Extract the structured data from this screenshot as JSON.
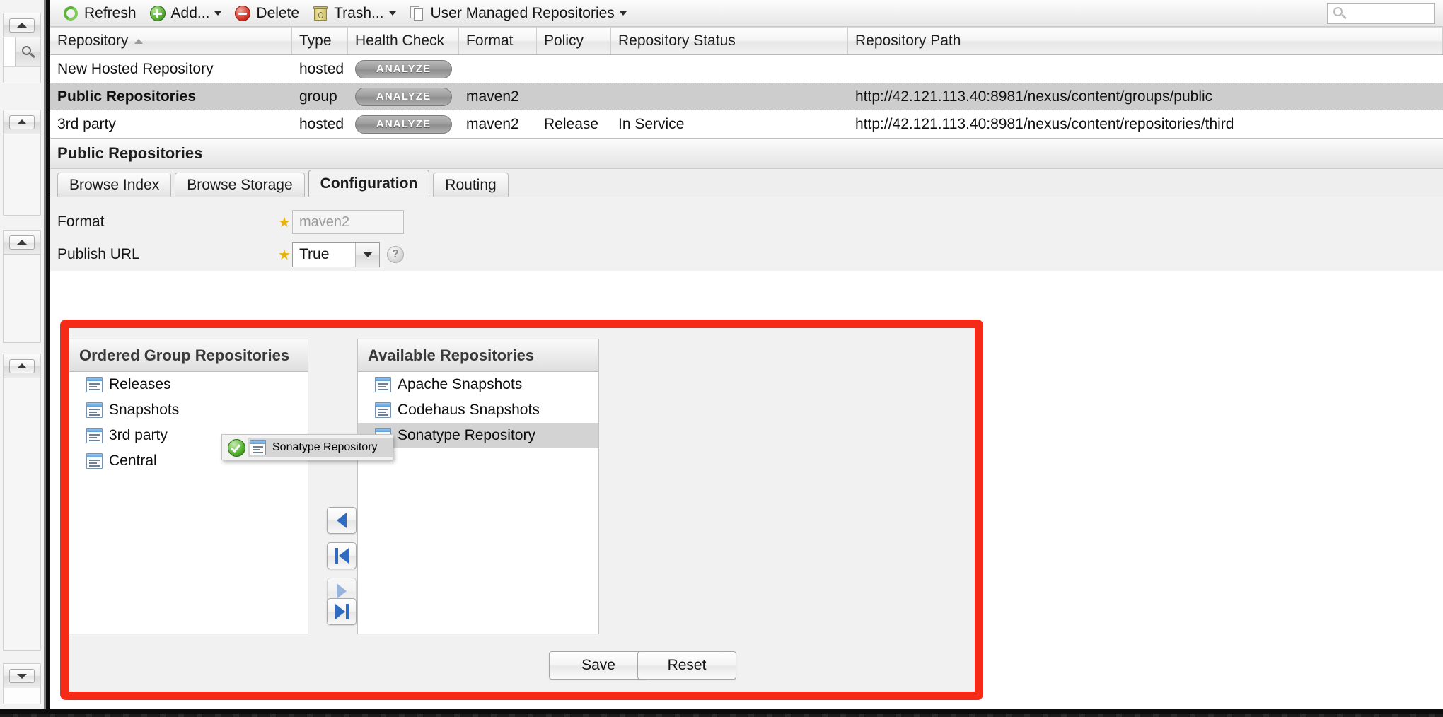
{
  "toolbar": {
    "items": [
      {
        "label": "Refresh",
        "icon": "refresh-icon",
        "caret": false
      },
      {
        "label": "Add...",
        "icon": "add-icon",
        "caret": true
      },
      {
        "label": "Delete",
        "icon": "delete-icon",
        "caret": false
      },
      {
        "label": "Trash...",
        "icon": "trash-icon",
        "caret": true
      },
      {
        "label": "User Managed Repositories",
        "icon": "pages-icon",
        "caret": true
      }
    ],
    "search": {
      "value": "",
      "placeholder": "",
      "icon": "search-icon"
    }
  },
  "grid": {
    "columns": [
      {
        "label": "Repository",
        "sorted": true,
        "sort_dir": "asc"
      },
      {
        "label": "Type"
      },
      {
        "label": "Health Check"
      },
      {
        "label": "Format"
      },
      {
        "label": "Policy"
      },
      {
        "label": "Repository Status"
      },
      {
        "label": "Repository Path"
      }
    ],
    "health_check_label": "ANALYZE",
    "rows": [
      {
        "repository": "New Hosted Repository",
        "type": "hosted",
        "health": "ANALYZE",
        "format": "",
        "policy": "",
        "status": "",
        "path": "",
        "selected": false
      },
      {
        "repository": "Public Repositories",
        "type": "group",
        "health": "ANALYZE",
        "format": "maven2",
        "policy": "",
        "status": "",
        "path": "http://42.121.113.40:8981/nexus/content/groups/public",
        "selected": true
      },
      {
        "repository": "3rd party",
        "type": "hosted",
        "health": "ANALYZE",
        "format": "maven2",
        "policy": "Release",
        "status": "In Service",
        "path": "http://42.121.113.40:8981/nexus/content/repositories/third",
        "selected": false
      }
    ]
  },
  "detail": {
    "title": "Public Repositories",
    "tabs": [
      {
        "label": "Browse Index",
        "active": false
      },
      {
        "label": "Browse Storage",
        "active": false
      },
      {
        "label": "Configuration",
        "active": true
      },
      {
        "label": "Routing",
        "active": false
      }
    ],
    "fields": [
      {
        "label": "Format",
        "required": true,
        "value": "maven2",
        "type": "text",
        "readonly": true
      },
      {
        "label": "Publish URL",
        "required": true,
        "value": "True",
        "type": "select",
        "help": "?"
      }
    ]
  },
  "group_editor": {
    "ordered": {
      "title": "Ordered Group Repositories",
      "items": [
        {
          "label": "Releases",
          "icon": "repository-icon",
          "selected": false
        },
        {
          "label": "Snapshots",
          "icon": "repository-icon",
          "selected": false
        },
        {
          "label": "3rd party",
          "icon": "repository-icon",
          "selected": false
        },
        {
          "label": "Central",
          "icon": "repository-icon",
          "selected": false
        }
      ]
    },
    "available": {
      "title": "Available Repositories",
      "items": [
        {
          "label": "Apache Snapshots",
          "icon": "repository-icon",
          "selected": false
        },
        {
          "label": "Codehaus Snapshots",
          "icon": "repository-icon",
          "selected": false
        },
        {
          "label": "Sonatype Repository",
          "icon": "repository-icon",
          "selected": true
        }
      ]
    },
    "transfer_buttons": [
      {
        "name": "move-left-button",
        "icon": "arrow-left-icon"
      },
      {
        "name": "move-all-left-button",
        "icon": "arrow-left-bar-icon"
      },
      {
        "name": "move-right-button",
        "icon": "arrow-right-icon"
      },
      {
        "name": "move-all-right-button",
        "icon": "arrow-right-bar-icon"
      }
    ],
    "drag_ghost": {
      "label": "Sonatype Repository",
      "status_icon": "check-circle-icon"
    },
    "save_label": "Save",
    "reset_label": "Reset"
  },
  "sidebar": {
    "panels": [
      {
        "collapse_icon": "chevron-up-icon",
        "has_search": true
      },
      {
        "collapse_icon": "chevron-up-icon",
        "has_search": false
      },
      {
        "collapse_icon": "chevron-up-icon",
        "has_search": false
      },
      {
        "collapse_icon": "chevron-up-icon",
        "has_search": false
      },
      {
        "collapse_icon": "chevron-down-icon",
        "has_search": false
      }
    ],
    "search_icon": "magnifier-icon"
  },
  "colors": {
    "highlight_box": "#f62b17",
    "link": "#2d4b80",
    "selected_row": "#cdcdcd",
    "accent_blue": "#2f6bc0"
  }
}
